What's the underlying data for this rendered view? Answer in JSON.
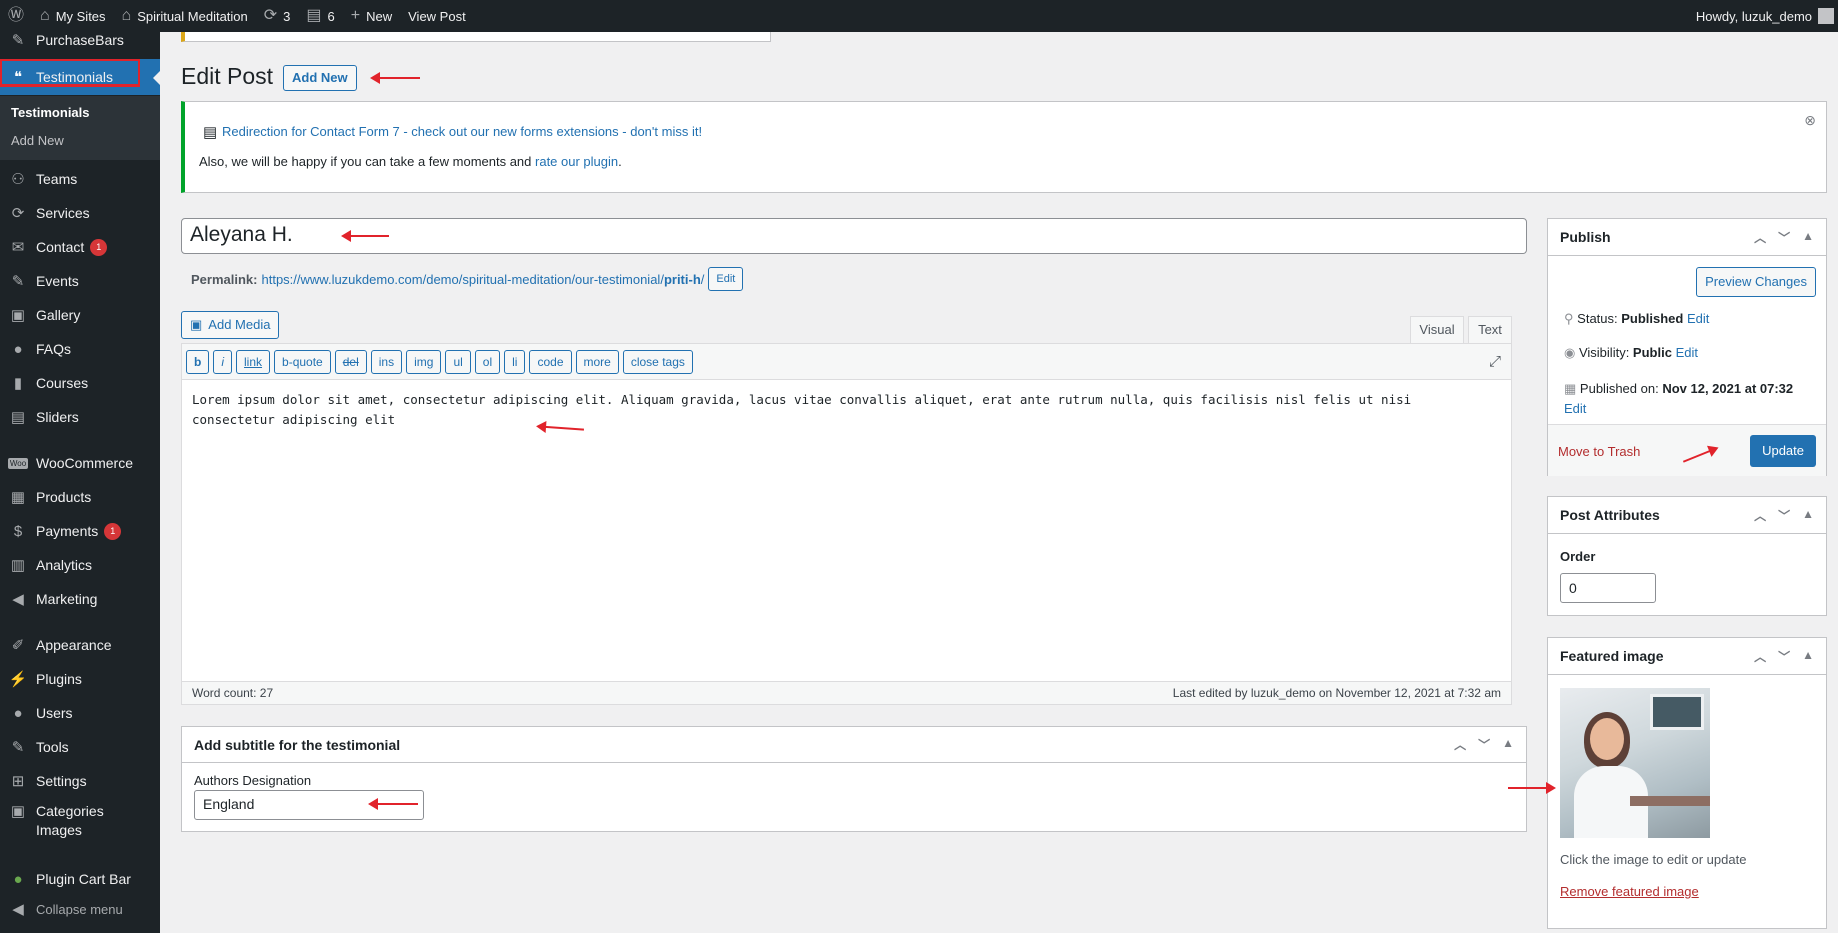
{
  "adminbar": {
    "my_sites": "My Sites",
    "site_name": "Spiritual Meditation",
    "updates_count": "3",
    "comments_count": "6",
    "new_label": "New",
    "view_post": "View Post",
    "howdy": "Howdy, luzuk_demo"
  },
  "sidebar": {
    "purchasebars": "PurchaseBars",
    "testimonials": "Testimonials",
    "sub_testimonials": "Testimonials",
    "sub_add_new": "Add New",
    "teams": "Teams",
    "services": "Services",
    "contact": "Contact",
    "contact_badge": "1",
    "events": "Events",
    "gallery": "Gallery",
    "faqs": "FAQs",
    "courses": "Courses",
    "sliders": "Sliders",
    "woocommerce": "WooCommerce",
    "products": "Products",
    "payments": "Payments",
    "payments_badge": "1",
    "analytics": "Analytics",
    "marketing": "Marketing",
    "appearance": "Appearance",
    "plugins": "Plugins",
    "users": "Users",
    "tools": "Tools",
    "settings": "Settings",
    "categories_images_1": "Categories",
    "categories_images_2": "Images",
    "plugin_cart_bar": "Plugin Cart Bar",
    "collapse": "Collapse menu",
    "woo_icon": "Woo"
  },
  "page": {
    "title": "Edit Post",
    "add_new": "Add New"
  },
  "notice": {
    "link_text": "Redirection for Contact Form 7 - check out our new forms extensions - don't miss it!",
    "text_before": "Also, we will be happy if you can take a few moments and ",
    "rate_link": "rate our plugin",
    "text_after": "."
  },
  "post": {
    "title": "Aleyana H.",
    "permalink_label": "Permalink:",
    "permalink_base": "https://www.luzukdemo.com/demo/spiritual-meditation/our-testimonial/",
    "permalink_slug": "priti-h",
    "permalink_end": "/",
    "permalink_edit": "Edit",
    "add_media": "Add Media",
    "tab_visual": "Visual",
    "tab_text": "Text",
    "quicktags": [
      "b",
      "i",
      "link",
      "b-quote",
      "del",
      "ins",
      "img",
      "ul",
      "ol",
      "li",
      "code",
      "more",
      "close tags"
    ],
    "content": "Lorem ipsum dolor sit amet, consectetur adipiscing elit. Aliquam gravida, lacus vitae convallis aliquet, erat ante rutrum nulla, quis facilisis nisl felis ut nisi consectetur adipiscing elit",
    "word_count": "Word count: 27",
    "last_edited": "Last edited by luzuk_demo on November 12, 2021 at 7:32 am"
  },
  "subtitle_box": {
    "heading": "Add subtitle for the testimonial",
    "field_label": "Authors Designation",
    "field_value": "England"
  },
  "publish": {
    "heading": "Publish",
    "preview": "Preview Changes",
    "status_label": "Status: ",
    "status_value": "Published",
    "visibility_label": "Visibility: ",
    "visibility_value": "Public",
    "published_label": "Published on: ",
    "published_value": "Nov 12, 2021 at 07:32",
    "edit": "Edit",
    "trash": "Move to Trash",
    "update": "Update"
  },
  "attributes": {
    "heading": "Post Attributes",
    "order_label": "Order",
    "order_value": "0"
  },
  "featured": {
    "heading": "Featured image",
    "hint": "Click the image to edit or update",
    "remove": "Remove featured image"
  },
  "colors": {
    "admin_bg": "#1d2327",
    "accent": "#2271b1",
    "annotation_red": "#e1232b",
    "notice_green": "#00a32a"
  }
}
